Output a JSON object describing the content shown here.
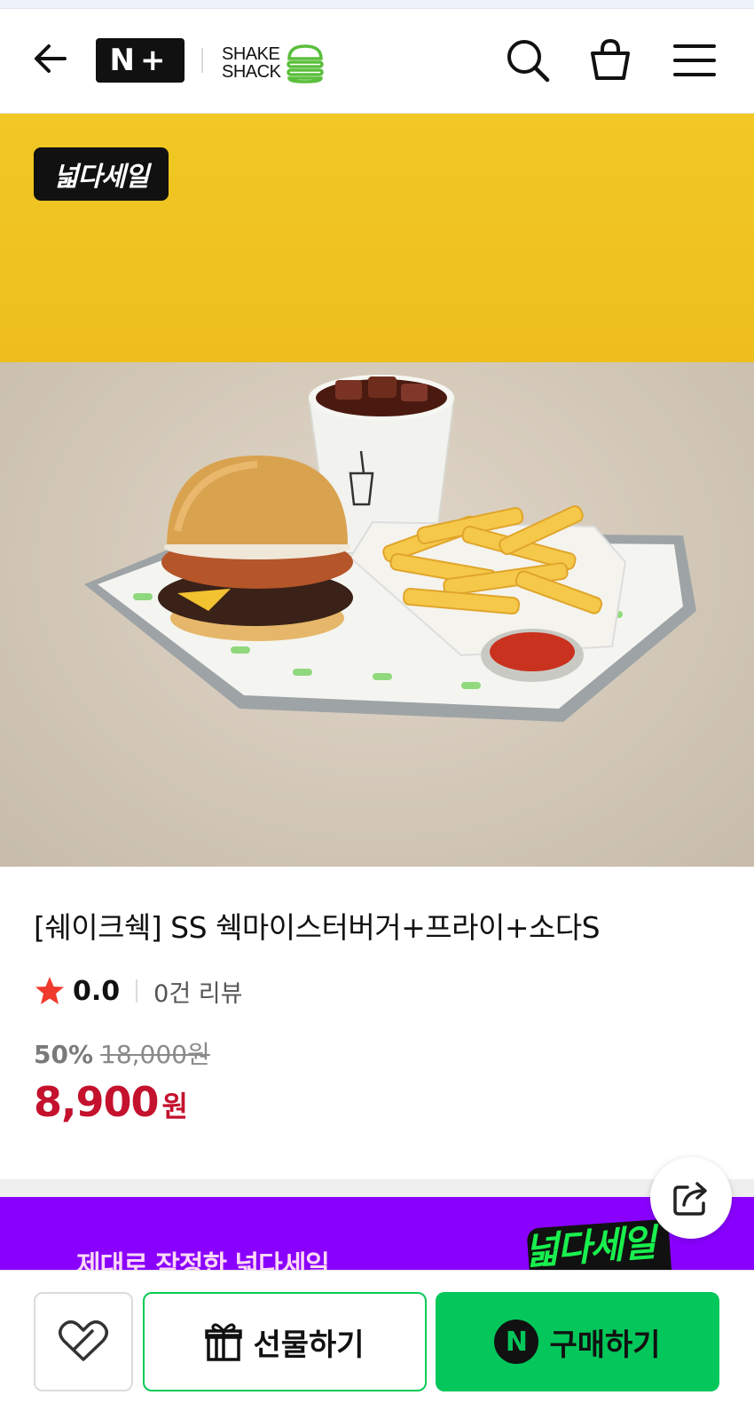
{
  "header": {
    "nplus_logo": "N+",
    "brand_logo_line1": "SHAKE",
    "brand_logo_line2": "SHACK"
  },
  "hero": {
    "badge": "넓다세일"
  },
  "product": {
    "title": "[쉐이크쉑] SS 쉑마이스터버거+프라이+소다S",
    "rating": "0.0",
    "review_count_text": "0건 리뷰",
    "discount_rate": "50%",
    "original_price": "18,000원",
    "sale_price": "8,900",
    "price_unit": "원"
  },
  "banner": {
    "text": "제대로 작정한 넓다세일",
    "logo": "넓다세일",
    "background": "#8a00ff"
  },
  "bottom_bar": {
    "gift_label": "선물하기",
    "buy_label": "구매하기",
    "buy_badge": "N"
  },
  "colors": {
    "accent_green": "#03c75a",
    "price_red": "#c4112d",
    "hero_yellow": "#f1c824"
  },
  "icons": {
    "back": "arrow-left-icon",
    "search": "search-icon",
    "cart": "shopping-bag-icon",
    "menu": "hamburger-menu-icon",
    "share": "share-icon",
    "wish": "heart-outline-icon",
    "gift": "gift-icon",
    "star": "star-icon"
  }
}
